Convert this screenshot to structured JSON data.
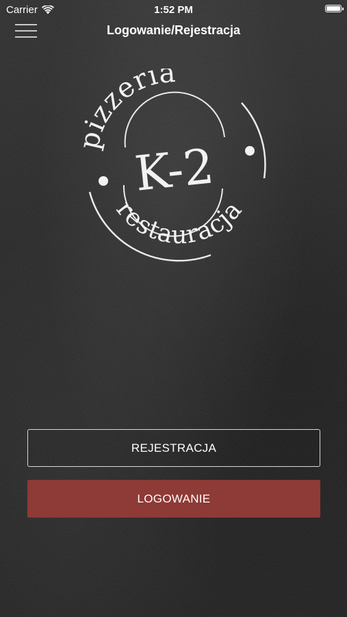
{
  "status_bar": {
    "carrier": "Carrier",
    "time": "1:52 PM",
    "wifi_icon": "wifi-icon",
    "battery_icon": "battery-icon"
  },
  "nav": {
    "menu_icon": "hamburger-menu-icon",
    "title": "Logowanie/Rejestracja"
  },
  "logo": {
    "top_text": "pizzeria",
    "center_text": "K-2",
    "bottom_text": "restauracja"
  },
  "actions": {
    "register_label": "REJESTRACJA",
    "login_label": "LOGOWANIE"
  },
  "colors": {
    "background": "#242424",
    "login_button": "#8e3a36",
    "register_border": "#d8d8d8",
    "text": "#ffffff"
  }
}
